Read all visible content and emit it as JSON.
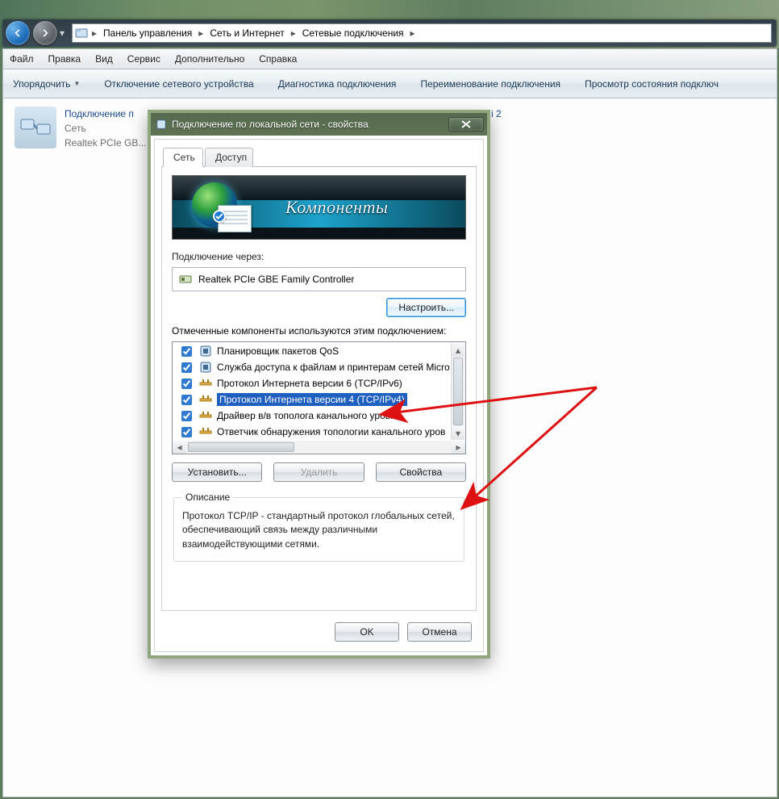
{
  "nav": {
    "crumbs": [
      "Панель управления",
      "Сеть и Интернет",
      "Сетевые подключения"
    ]
  },
  "menubar": [
    "Файл",
    "Правка",
    "Вид",
    "Сервис",
    "Дополнительно",
    "Справка"
  ],
  "toolbar": {
    "organize": "Упорядочить",
    "disable": "Отключение сетевого устройства",
    "diagnose": "Диагностика подключения",
    "rename": "Переименование подключения",
    "status": "Просмотр состояния подключ"
  },
  "connection_item": {
    "title": "Подключение п",
    "line2": "Сеть",
    "line3": "Realtek PCIe GB..."
  },
  "peek_item2": "і 2",
  "dialog": {
    "title": "Подключение по локальной сети - свойства",
    "tabs": {
      "network": "Сеть",
      "access": "Доступ"
    },
    "banner_text": "Компоненты",
    "connect_via_label": "Подключение через:",
    "adapter": "Realtek PCIe GBE Family Controller",
    "configure_btn": "Настроить...",
    "components_label": "Отмеченные компоненты используются этим подключением:",
    "components": [
      {
        "label": "Планировщик пакетов QoS",
        "checked": true,
        "icon": "component"
      },
      {
        "label": "Служба доступа к файлам и принтерам сетей Micro",
        "checked": true,
        "icon": "component"
      },
      {
        "label": "Протокол Интернета версии 6 (TCP/IPv6)",
        "checked": true,
        "icon": "protocol"
      },
      {
        "label": "Протокол Интернета версии 4 (TCP/IPv4)",
        "checked": true,
        "icon": "protocol",
        "selected": true
      },
      {
        "label": "Драйвер в/в тополога канального уровня",
        "checked": true,
        "icon": "protocol"
      },
      {
        "label": "Ответчик обнаружения топологии канального уров",
        "checked": true,
        "icon": "protocol"
      }
    ],
    "install_btn": "Установить...",
    "remove_btn": "Удалить",
    "properties_btn": "Свойства",
    "desc_legend": "Описание",
    "desc_text": "Протокол TCP/IP - стандартный протокол глобальных сетей, обеспечивающий связь между различными взаимодействующими сетями.",
    "ok": "OK",
    "cancel": "Отмена"
  }
}
